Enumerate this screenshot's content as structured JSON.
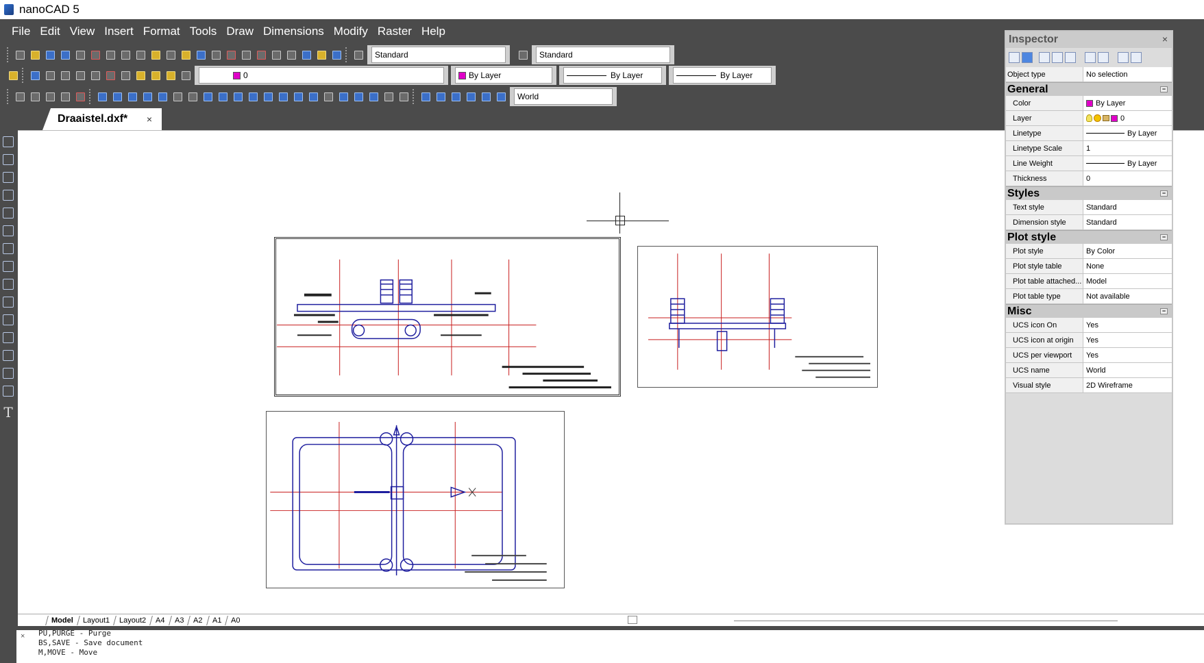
{
  "app": {
    "title": "nanoCAD 5"
  },
  "menu": [
    "File",
    "Edit",
    "View",
    "Insert",
    "Format",
    "Tools",
    "Draw",
    "Dimensions",
    "Modify",
    "Raster",
    "Help"
  ],
  "toolbars": {
    "text_style": "Standard",
    "dim_style": "Standard",
    "layer_value": "0",
    "color_value": "By Layer",
    "linetype_value": "By Layer",
    "lineweight_value": "By Layer",
    "ucs_value": "World"
  },
  "document": {
    "tab_title": "Draaistel.dxf*",
    "close_glyph": "×"
  },
  "layout_tabs": [
    "Model",
    "Layout1",
    "Layout2",
    "A4",
    "A3",
    "A2",
    "A1",
    "A0"
  ],
  "command_history": [
    "PU,PURGE - Purge",
    "BS,SAVE - Save document",
    "M,MOVE - Move"
  ],
  "inspector": {
    "title": "Inspector",
    "close_glyph": "×",
    "object_type_label": "Object type",
    "object_type_value": "No selection",
    "sections": {
      "general": {
        "title": "General",
        "color": {
          "label": "Color",
          "value": "By Layer"
        },
        "layer": {
          "label": "Layer",
          "value": "0"
        },
        "linetype": {
          "label": "Linetype",
          "value": "By Layer"
        },
        "linetype_scale": {
          "label": "Linetype Scale",
          "value": "1"
        },
        "line_weight": {
          "label": "Line Weight",
          "value": "By Layer"
        },
        "thickness": {
          "label": "Thickness",
          "value": "0"
        }
      },
      "styles": {
        "title": "Styles",
        "text_style": {
          "label": "Text style",
          "value": "Standard"
        },
        "dimension_style": {
          "label": "Dimension style",
          "value": "Standard"
        }
      },
      "plot": {
        "title": "Plot style",
        "plot_style": {
          "label": "Plot style",
          "value": "By Color"
        },
        "plot_style_table": {
          "label": "Plot style table",
          "value": "None"
        },
        "plot_table_attached": {
          "label": "Plot table attached...",
          "value": "Model"
        },
        "plot_table_type": {
          "label": "Plot table type",
          "value": "Not available"
        }
      },
      "misc": {
        "title": "Misc",
        "ucs_icon_on": {
          "label": "UCS icon On",
          "value": "Yes"
        },
        "ucs_icon_origin": {
          "label": "UCS icon at origin",
          "value": "Yes"
        },
        "ucs_per_viewport": {
          "label": "UCS per viewport",
          "value": "Yes"
        },
        "ucs_name": {
          "label": "UCS name",
          "value": "World"
        },
        "visual_style": {
          "label": "Visual style",
          "value": "2D Wireframe"
        }
      }
    }
  },
  "colors": {
    "accent_layer": "#e000c8",
    "drawing_blue": "#1e1e9e",
    "drawing_red": "#c81e1e"
  }
}
